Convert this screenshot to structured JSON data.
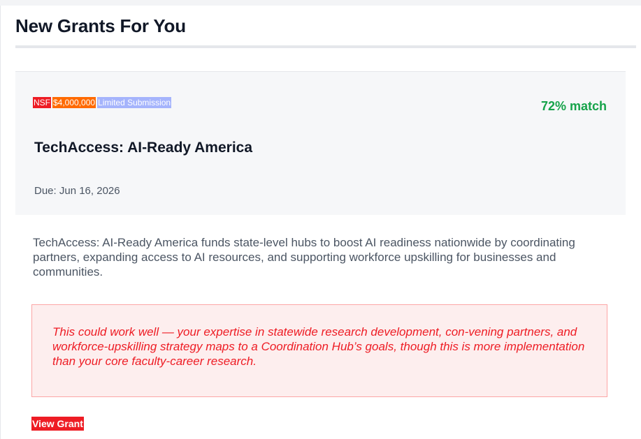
{
  "section": {
    "heading": "New Grants For You"
  },
  "grant": {
    "badges": {
      "agency": "NSF",
      "amount": "$4,000,000",
      "type": "Limited Submission"
    },
    "match": "72% match",
    "title": "TechAccess: AI-Ready America",
    "due": "Due: Jun 16, 2026",
    "description": "TechAccess: AI-Ready America funds state-level hubs to boost AI readiness nationwide by coordinating partners, expanding access to AI resources, and supporting workforce upskilling for businesses and communities.",
    "recommendation": "This could work well — your expertise in statewide research development, con-vening partners, and workforce-upskilling strategy maps to a Coordination Hub’s goals, though this is more implementation than your core faculty-career research.",
    "view_label": "View Grant"
  },
  "colors": {
    "agency_badge": "#ee1c24",
    "amount_badge": "#ff6a00",
    "type_badge": "#a5b4fc",
    "match_green": "#16a34a",
    "recommendation_red": "#ee1c24"
  }
}
